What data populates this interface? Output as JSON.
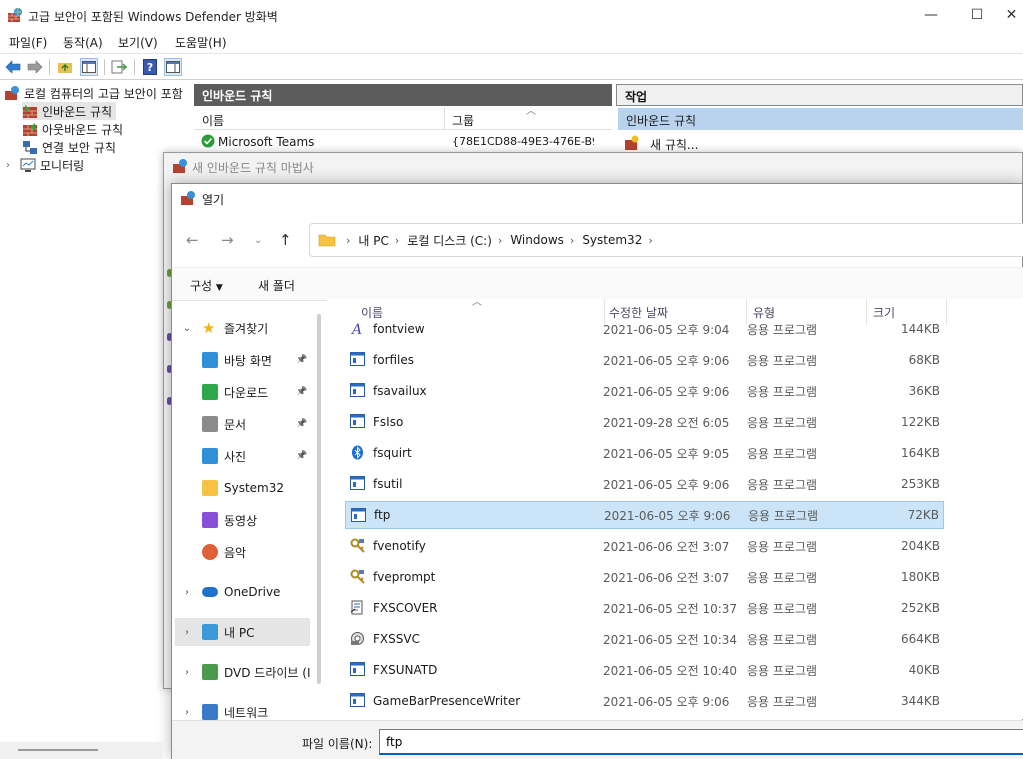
{
  "main_window": {
    "title": "고급 보안이 포함된 Windows Defender 방화벽",
    "controls": {
      "minimize": "—",
      "maximize": "☐",
      "close": "✕"
    }
  },
  "menubar": {
    "items": [
      "파일(F)",
      "동작(A)",
      "보기(V)",
      "도움말(H)"
    ]
  },
  "tree": {
    "root": "로컬 컴퓨터의 고급 보안이 포함",
    "items": [
      "인바운드 규칙",
      "아웃바운드 규칙",
      "연결 보안 규칙",
      "모니터링"
    ]
  },
  "middle_panel": {
    "header": "인바운드 규칙",
    "columns": [
      "이름",
      "그룹"
    ],
    "row": {
      "name": "Microsoft Teams",
      "group": "{78E1CD88-49E3-476E-B9"
    }
  },
  "right_panel": {
    "header": "작업",
    "section": "인바운드 규칙",
    "action": "새 규칙..."
  },
  "wizard": {
    "title": "새 인바운드 규칙 마법사"
  },
  "open_dialog": {
    "title": "열기",
    "breadcrumb": [
      "내 PC",
      "로컬 디스크 (C:)",
      "Windows",
      "System32"
    ],
    "commands": {
      "organize": "구성",
      "new_folder": "새 폴더"
    },
    "nav": [
      {
        "label": "즐겨찾기",
        "icon": "star-icon",
        "color": "#f2b416"
      },
      {
        "label": "바탕 화면",
        "icon": "desktop-icon",
        "color": "#2f8fd8",
        "pinned": true
      },
      {
        "label": "다운로드",
        "icon": "download-icon",
        "color": "#2aa84a",
        "pinned": true
      },
      {
        "label": "문서",
        "icon": "document-icon",
        "color": "#8a8a8a",
        "pinned": true
      },
      {
        "label": "사진",
        "icon": "pictures-icon",
        "color": "#2f8fd8",
        "pinned": true
      },
      {
        "label": "System32",
        "icon": "folder-icon",
        "color": "#f5c242"
      },
      {
        "label": "동영상",
        "icon": "videos-icon",
        "color": "#8a4fd8"
      },
      {
        "label": "음악",
        "icon": "music-icon",
        "color": "#e0603a"
      },
      {
        "label": "OneDrive",
        "icon": "cloud-icon",
        "color": "#1e72c8"
      },
      {
        "label": "내 PC",
        "icon": "pc-icon",
        "color": "#3a9ad9"
      },
      {
        "label": "DVD 드라이브 (I",
        "icon": "dvd-icon",
        "color": "#4a9a4a"
      },
      {
        "label": "네트워크",
        "icon": "network-icon",
        "color": "#3a7ac8"
      }
    ],
    "columns": [
      "이름",
      "수정한 날짜",
      "유형",
      "크기"
    ],
    "files": [
      {
        "name": "fontview",
        "date": "2021-06-05 오후 9:04",
        "type": "응용 프로그램",
        "size": "144KB",
        "icon": "font-icon"
      },
      {
        "name": "forfiles",
        "date": "2021-06-05 오후 9:06",
        "type": "응용 프로그램",
        "size": "68KB",
        "icon": "exe-icon"
      },
      {
        "name": "fsavailux",
        "date": "2021-06-05 오후 9:06",
        "type": "응용 프로그램",
        "size": "36KB",
        "icon": "exe-icon"
      },
      {
        "name": "FsIso",
        "date": "2021-09-28 오전 6:05",
        "type": "응용 프로그램",
        "size": "122KB",
        "icon": "exe-icon"
      },
      {
        "name": "fsquirt",
        "date": "2021-06-05 오후 9:05",
        "type": "응용 프로그램",
        "size": "164KB",
        "icon": "bluetooth-icon"
      },
      {
        "name": "fsutil",
        "date": "2021-06-05 오후 9:06",
        "type": "응용 프로그램",
        "size": "253KB",
        "icon": "exe-icon"
      },
      {
        "name": "ftp",
        "date": "2021-06-05 오후 9:06",
        "type": "응용 프로그램",
        "size": "72KB",
        "icon": "exe-icon",
        "selected": true
      },
      {
        "name": "fvenotify",
        "date": "2021-06-06 오전 3:07",
        "type": "응용 프로그램",
        "size": "204KB",
        "icon": "key-icon"
      },
      {
        "name": "fveprompt",
        "date": "2021-06-06 오전 3:07",
        "type": "응용 프로그램",
        "size": "180KB",
        "icon": "key-icon"
      },
      {
        "name": "FXSCOVER",
        "date": "2021-06-05 오전 10:37",
        "type": "응용 프로그램",
        "size": "252KB",
        "icon": "fax-cover-icon"
      },
      {
        "name": "FXSSVC",
        "date": "2021-06-05 오전 10:34",
        "type": "응용 프로그램",
        "size": "664KB",
        "icon": "fax-service-icon"
      },
      {
        "name": "FXSUNATD",
        "date": "2021-06-05 오전 10:40",
        "type": "응용 프로그램",
        "size": "40KB",
        "icon": "exe-icon"
      },
      {
        "name": "GameBarPresenceWriter",
        "date": "2021-06-05 오후 9:06",
        "type": "응용 프로그램",
        "size": "344KB",
        "icon": "exe-icon"
      }
    ],
    "filename_label": "파일 이름(N):",
    "filename_value": "ftp"
  }
}
